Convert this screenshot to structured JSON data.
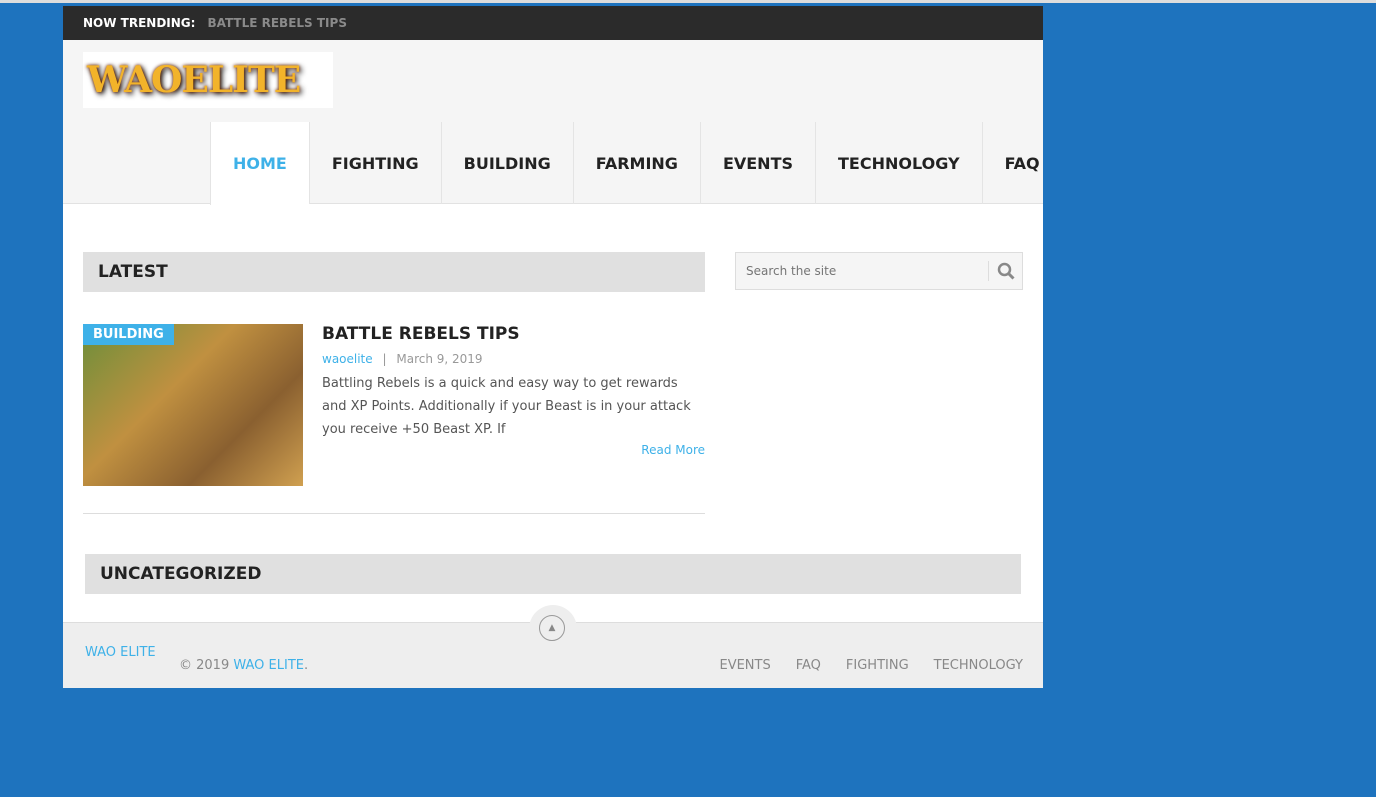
{
  "trending": {
    "label": "NOW TRENDING:",
    "value": "BATTLE REBELS TIPS"
  },
  "logo": "WAOELITE",
  "nav": [
    "HOME",
    "FIGHTING",
    "BUILDING",
    "FARMING",
    "EVENTS",
    "TECHNOLOGY",
    "FAQ"
  ],
  "latest": {
    "title": "LATEST"
  },
  "search": {
    "placeholder": "Search the site"
  },
  "post": {
    "category": "BUILDING",
    "title": "BATTLE REBELS TIPS",
    "author": "waoelite",
    "sep": "|",
    "date": "March 9, 2019",
    "excerpt": "Battling Rebels is a quick and easy way to get rewards and XP Points. Additionally if your Beast is in your attack you receive +50 Beast XP. If",
    "read_more": "Read More"
  },
  "uncategorized": {
    "title": "UNCATEGORIZED"
  },
  "footer": {
    "logo_alt": "WAO ELITE",
    "copy_prefix": "© 2019 ",
    "copy_link": "WAO ELITE",
    "copy_suffix": ".",
    "links": [
      "EVENTS",
      "FAQ",
      "FIGHTING",
      "TECHNOLOGY"
    ]
  }
}
